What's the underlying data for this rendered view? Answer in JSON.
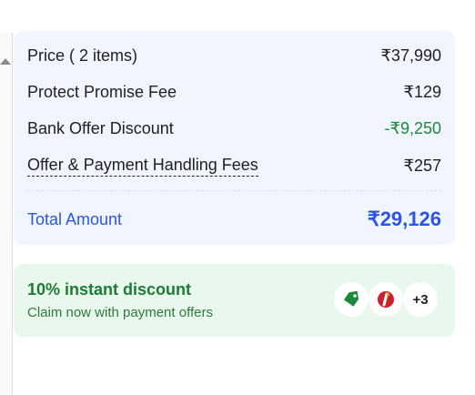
{
  "price_details": {
    "rows": [
      {
        "label": "Price ( 2 items)",
        "value": "₹37,990"
      },
      {
        "label": "Protect Promise Fee",
        "value": "₹129"
      },
      {
        "label": "Bank Offer Discount",
        "value": "-₹9,250"
      },
      {
        "label": "Offer & Payment Handling Fees",
        "value": "₹257"
      }
    ],
    "total_label": "Total Amount",
    "total_value": "₹29,126"
  },
  "offer": {
    "title": "10% instant discount",
    "subtitle": "Claim now with payment offers",
    "icons": [
      "tag-icon",
      "bank-logo-icon"
    ],
    "more_count": "+3"
  },
  "colors": {
    "card_bg": "#f0f5ff",
    "total_accent": "#2a55e5",
    "discount_green": "#1a8a3a",
    "offer_bg": "#e8f8ec"
  }
}
